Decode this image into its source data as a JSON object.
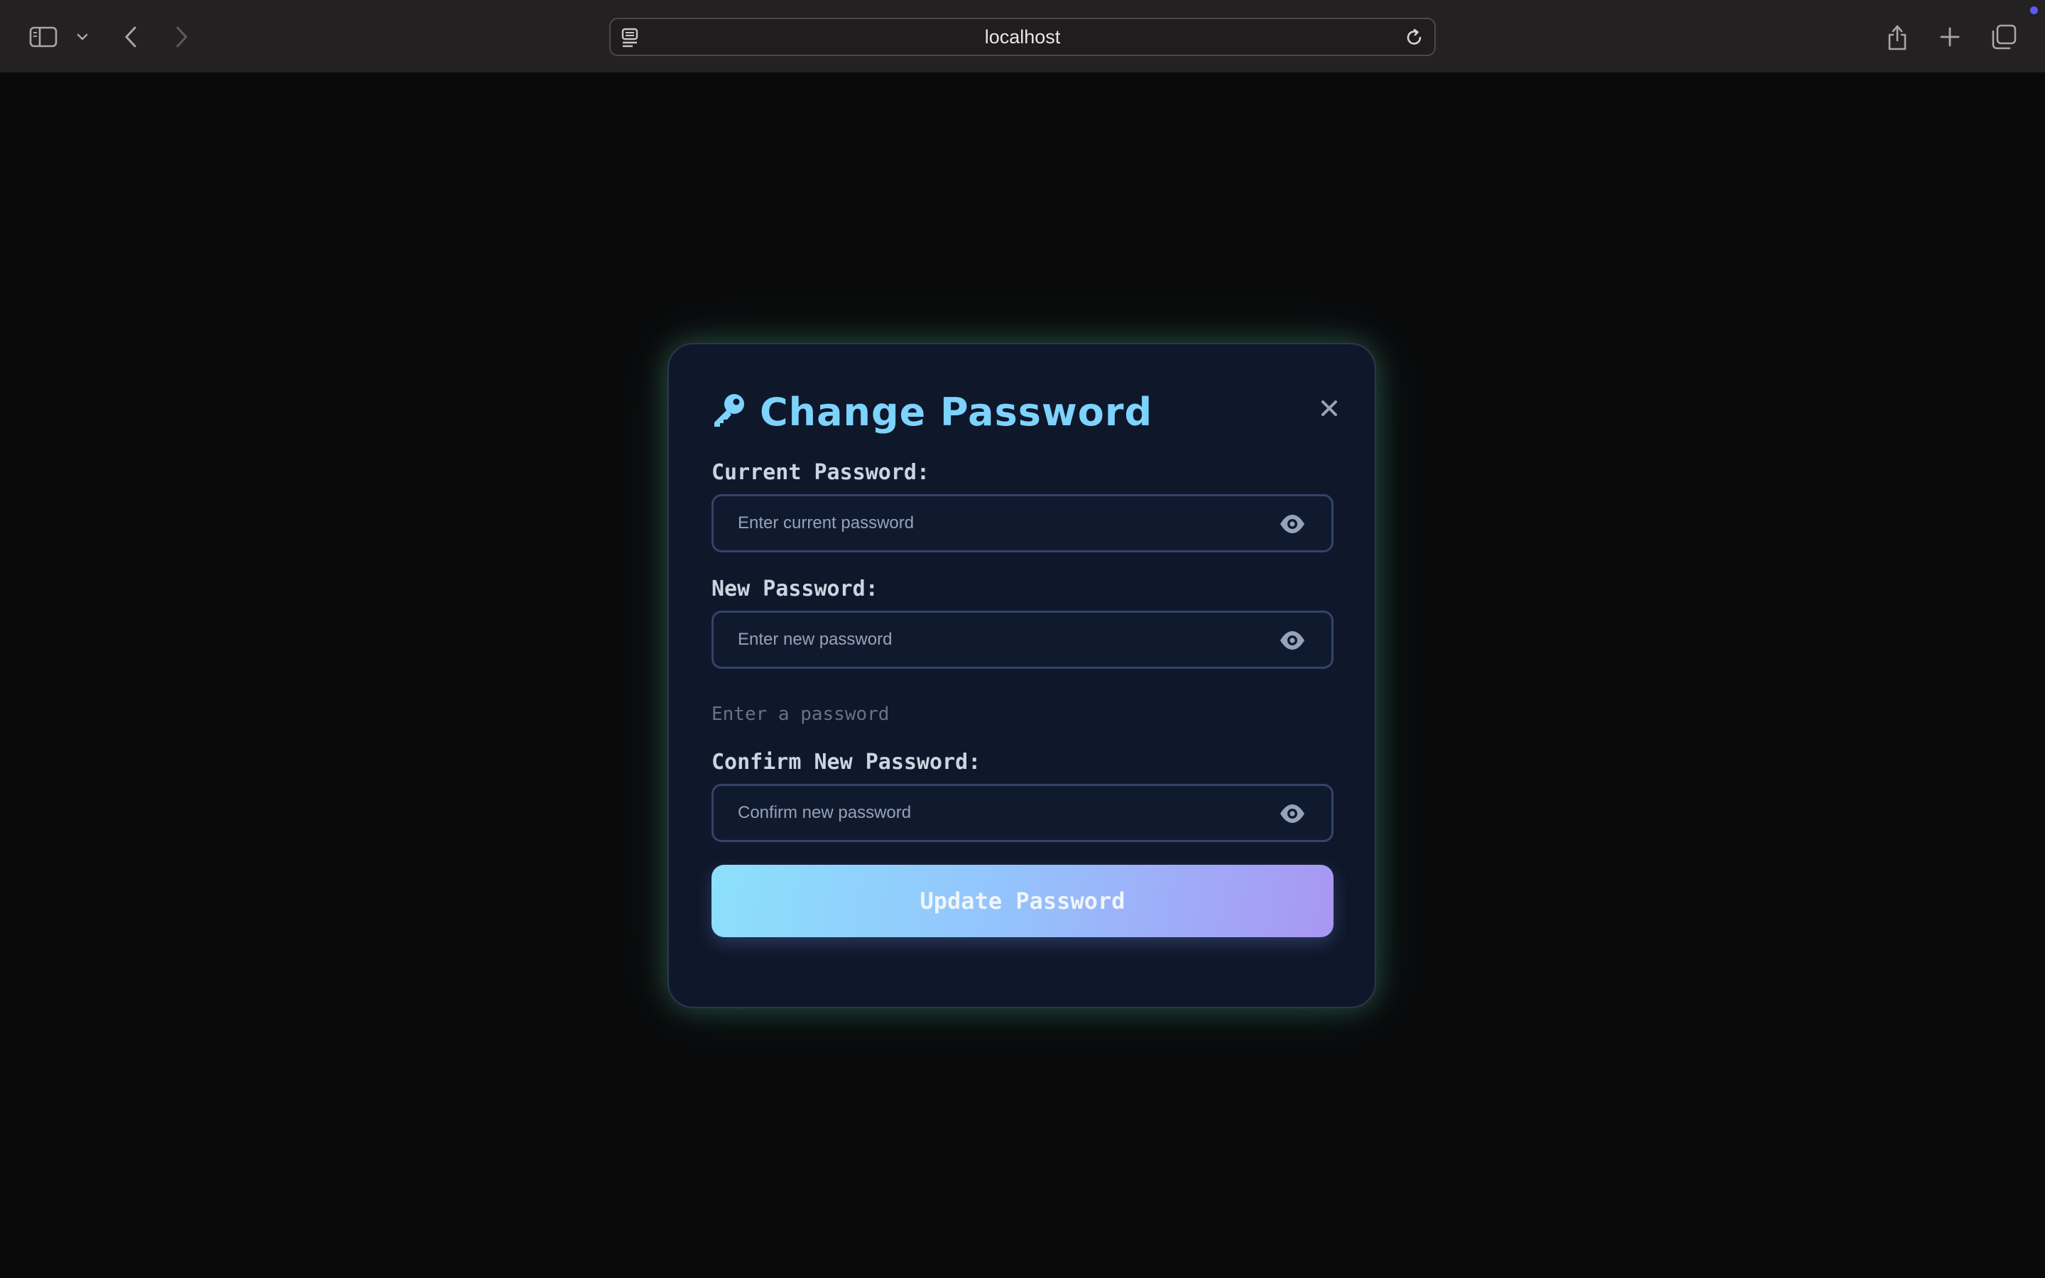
{
  "browser": {
    "url": "localhost"
  },
  "modal": {
    "title": "Change Password",
    "fields": [
      {
        "label": "Current Password:",
        "placeholder": "Enter current password",
        "value": ""
      },
      {
        "label": "New Password:",
        "placeholder": "Enter new password",
        "value": ""
      },
      {
        "label": "Confirm New Password:",
        "placeholder": "Confirm new password",
        "value": ""
      }
    ],
    "strength_hint": "Enter a password",
    "submit_label": "Update Password"
  },
  "icons": {
    "title": "key-icon",
    "close": "close-icon",
    "toggle": "eye-icon"
  },
  "colors": {
    "accent": "#7dd3fc",
    "gradient_start": "#8ce0fb",
    "gradient_end": "#a996f3",
    "modal_bg": "#0f172a",
    "glow": "#6ee7b7"
  }
}
